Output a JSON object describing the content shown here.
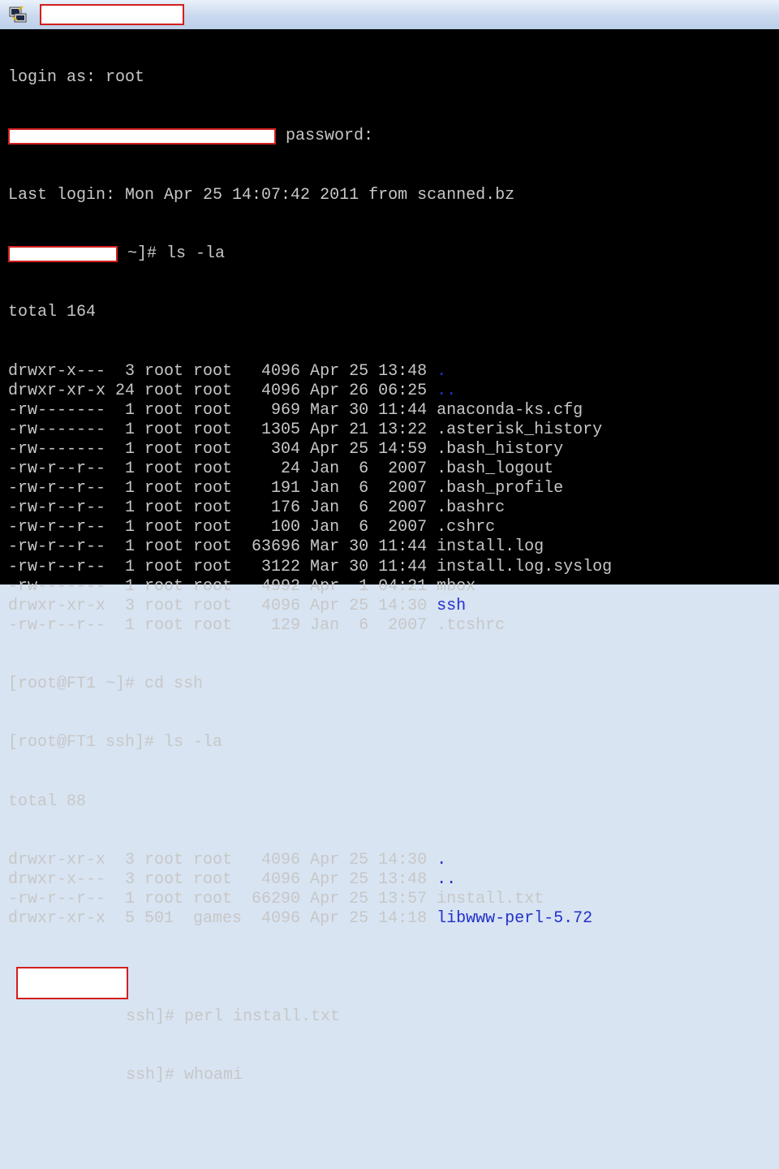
{
  "window": {
    "icon": "putty-terminal-icon",
    "title_redacted": true
  },
  "colors": {
    "background": "#000000",
    "text": "#c7c7c7",
    "directory": "#2230c8",
    "redaction_border": "#d21f1f"
  },
  "session": {
    "login_prompt": "login as: root",
    "password_prompt": "password:",
    "last_login": "Last login: Mon Apr 25 14:07:42 2011 from scanned.bz",
    "cmd1_suffix": "~]# ls -la",
    "total1": "total 164",
    "listing1": [
      {
        "perm": "drwxr-x---",
        "links": "3",
        "owner": "root",
        "group": "root",
        "size": "4096",
        "mon": "Apr",
        "day": "25",
        "time": "13:48",
        "name": ".",
        "dir": true
      },
      {
        "perm": "drwxr-xr-x",
        "links": "24",
        "owner": "root",
        "group": "root",
        "size": "4096",
        "mon": "Apr",
        "day": "26",
        "time": "06:25",
        "name": "..",
        "dir": true
      },
      {
        "perm": "-rw-------",
        "links": "1",
        "owner": "root",
        "group": "root",
        "size": "969",
        "mon": "Mar",
        "day": "30",
        "time": "11:44",
        "name": "anaconda-ks.cfg",
        "dir": false
      },
      {
        "perm": "-rw-------",
        "links": "1",
        "owner": "root",
        "group": "root",
        "size": "1305",
        "mon": "Apr",
        "day": "21",
        "time": "13:22",
        "name": ".asterisk_history",
        "dir": false
      },
      {
        "perm": "-rw-------",
        "links": "1",
        "owner": "root",
        "group": "root",
        "size": "304",
        "mon": "Apr",
        "day": "25",
        "time": "14:59",
        "name": ".bash_history",
        "dir": false
      },
      {
        "perm": "-rw-r--r--",
        "links": "1",
        "owner": "root",
        "group": "root",
        "size": "24",
        "mon": "Jan",
        "day": "6",
        "time": "2007",
        "name": ".bash_logout",
        "dir": false
      },
      {
        "perm": "-rw-r--r--",
        "links": "1",
        "owner": "root",
        "group": "root",
        "size": "191",
        "mon": "Jan",
        "day": "6",
        "time": "2007",
        "name": ".bash_profile",
        "dir": false
      },
      {
        "perm": "-rw-r--r--",
        "links": "1",
        "owner": "root",
        "group": "root",
        "size": "176",
        "mon": "Jan",
        "day": "6",
        "time": "2007",
        "name": ".bashrc",
        "dir": false
      },
      {
        "perm": "-rw-r--r--",
        "links": "1",
        "owner": "root",
        "group": "root",
        "size": "100",
        "mon": "Jan",
        "day": "6",
        "time": "2007",
        "name": ".cshrc",
        "dir": false
      },
      {
        "perm": "-rw-r--r--",
        "links": "1",
        "owner": "root",
        "group": "root",
        "size": "63696",
        "mon": "Mar",
        "day": "30",
        "time": "11:44",
        "name": "install.log",
        "dir": false
      },
      {
        "perm": "-rw-r--r--",
        "links": "1",
        "owner": "root",
        "group": "root",
        "size": "3122",
        "mon": "Mar",
        "day": "30",
        "time": "11:44",
        "name": "install.log.syslog",
        "dir": false
      },
      {
        "perm": "-rw-------",
        "links": "1",
        "owner": "root",
        "group": "root",
        "size": "4992",
        "mon": "Apr",
        "day": "1",
        "time": "04:21",
        "name": "mbox",
        "dir": false
      },
      {
        "perm": "drwxr-xr-x",
        "links": "3",
        "owner": "root",
        "group": "root",
        "size": "4096",
        "mon": "Apr",
        "day": "25",
        "time": "14:30",
        "name": "ssh",
        "dir": true
      },
      {
        "perm": "-rw-r--r--",
        "links": "1",
        "owner": "root",
        "group": "root",
        "size": "129",
        "mon": "Jan",
        "day": "6",
        "time": "2007",
        "name": ".tcshrc",
        "dir": false
      }
    ],
    "cmd2": "[root@FT1 ~]# cd ssh",
    "cmd3": "[root@FT1 ssh]# ls -la",
    "total2": "total 88",
    "listing2": [
      {
        "perm": "drwxr-xr-x",
        "links": "3",
        "owner": "root",
        "group": "root",
        "size": "4096",
        "mon": "Apr",
        "day": "25",
        "time": "14:30",
        "name": ".",
        "dir": true
      },
      {
        "perm": "drwxr-x---",
        "links": "3",
        "owner": "root",
        "group": "root",
        "size": "4096",
        "mon": "Apr",
        "day": "25",
        "time": "13:48",
        "name": "..",
        "dir": true
      },
      {
        "perm": "-rw-r--r--",
        "links": "1",
        "owner": "root",
        "group": "root",
        "size": "66290",
        "mon": "Apr",
        "day": "25",
        "time": "13:57",
        "name": "install.txt",
        "dir": false
      },
      {
        "perm": "drwxr-xr-x",
        "links": "5",
        "owner": "501",
        "group": "games",
        "size": "4096",
        "mon": "Apr",
        "day": "25",
        "time": "14:18",
        "name": "libwww-perl-5.72",
        "dir": true
      }
    ],
    "cmd4_suffix": "ssh]# perl install.txt",
    "cmd5_suffix": "ssh]# whoami"
  }
}
